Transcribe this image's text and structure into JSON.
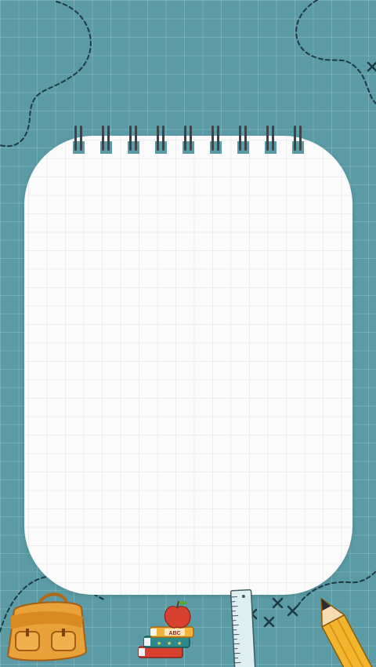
{
  "colors": {
    "background": "#5a9ba6",
    "gridline": "#8cbcc4",
    "paper": "#fbfbfb",
    "paper_grid": "#ececec",
    "dashed_path": "#1d3a44",
    "spiral_wire": "#3c4448"
  },
  "decorations": {
    "spiral_ring_count": 9,
    "icons": [
      "backpack-icon",
      "books-stack-icon",
      "apple-icon",
      "ruler-icon",
      "pencil-icon",
      "cross-mark-icon"
    ],
    "book_label": "ABC"
  }
}
